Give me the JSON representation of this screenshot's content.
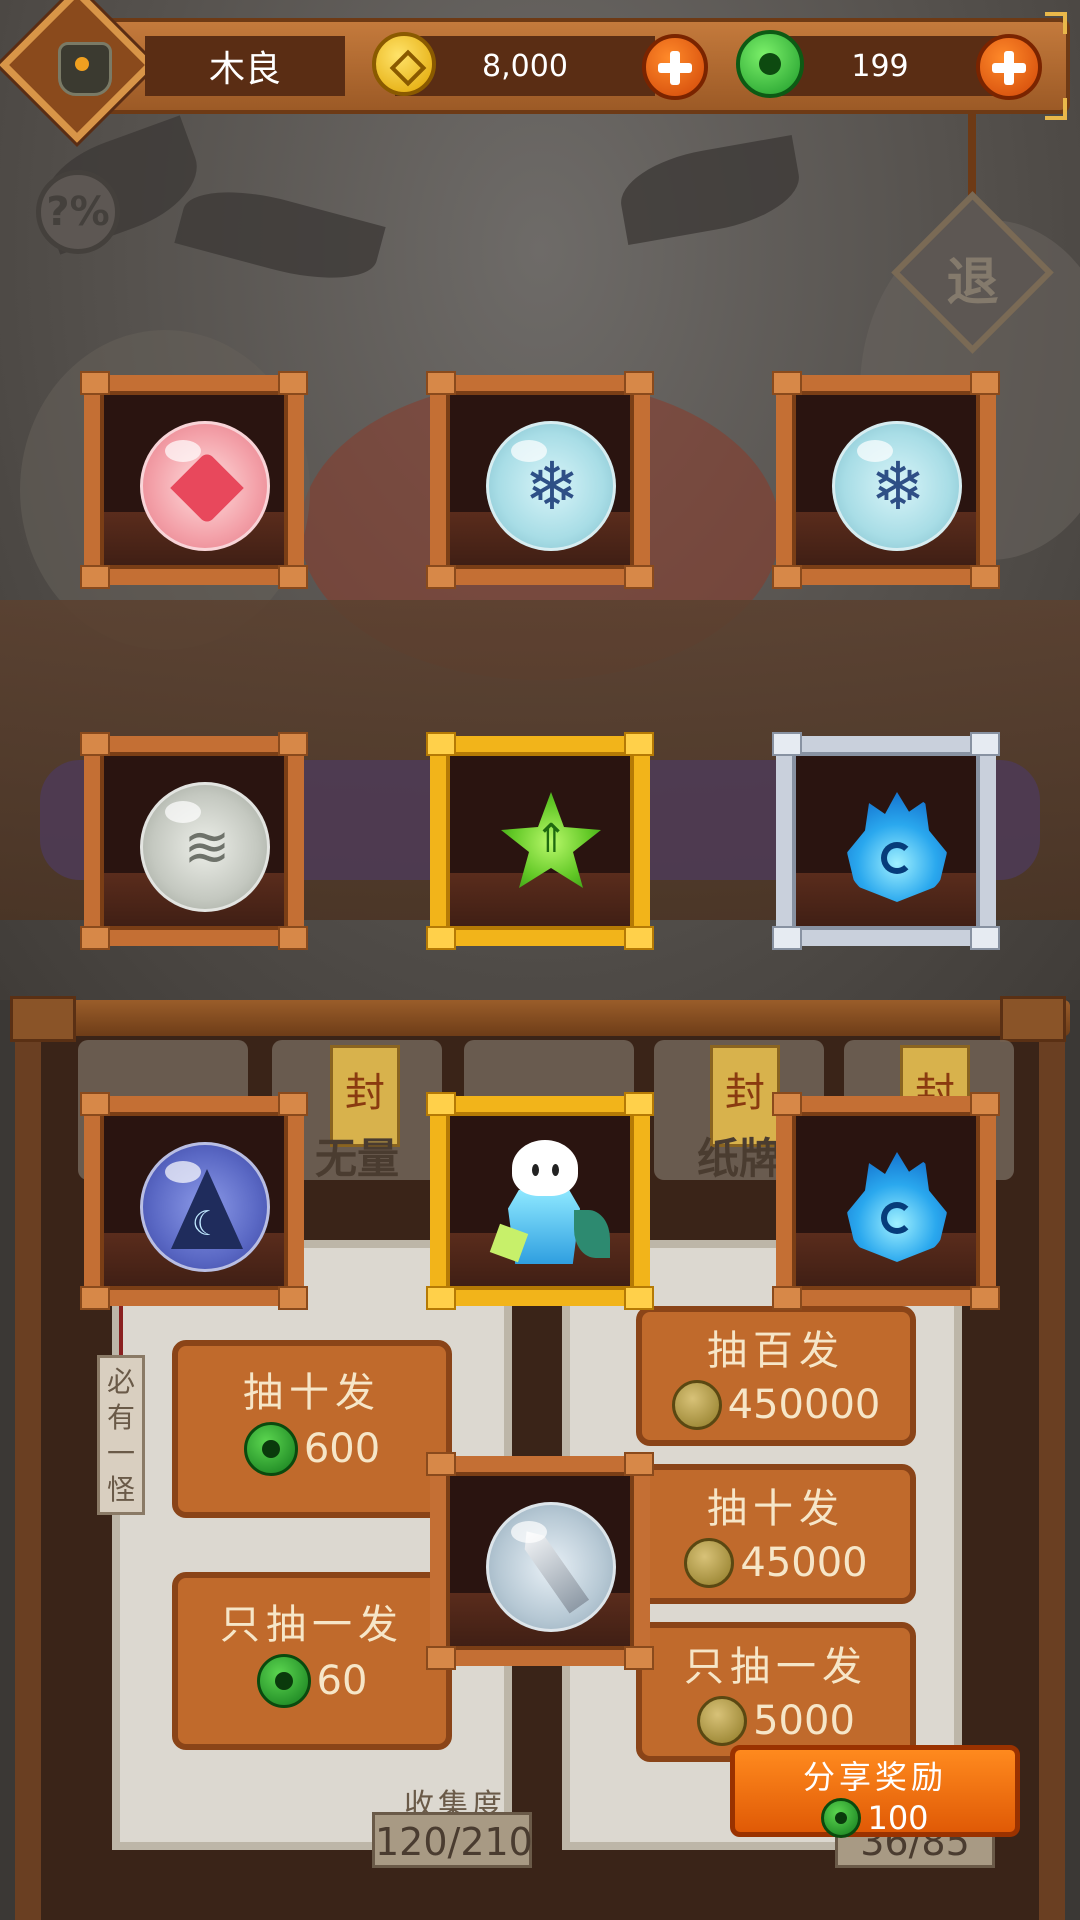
{
  "topbar": {
    "player_name": "木良",
    "gold_amount": "8,000",
    "jade_amount": "199",
    "icons": [
      "avatar-icon",
      "gold-coin-icon",
      "jade-coin-icon",
      "plus-icon"
    ]
  },
  "side": {
    "help_label": "?%",
    "exit_label": "退"
  },
  "categories": [
    {
      "label": ""
    },
    {
      "label": "无量",
      "seal": "封"
    },
    {
      "label": ""
    },
    {
      "label": "纸牌",
      "seal": "封"
    },
    {
      "label": "",
      "seal": "封"
    }
  ],
  "tag": {
    "text": "必有一怪"
  },
  "left_panel": {
    "draw_ten": {
      "title": "抽十发",
      "price": "600",
      "currency": "jade"
    },
    "draw_one": {
      "title": "只抽一发",
      "price": "60",
      "currency": "jade"
    },
    "collection_label": "收集度",
    "collection_value": "120/210"
  },
  "right_panel": {
    "draw_hundred": {
      "title": "抽百发",
      "price": "450000",
      "currency": "gold"
    },
    "draw_ten": {
      "title": "抽十发",
      "price": "45000",
      "currency": "gold"
    },
    "draw_one": {
      "title": "只抽一发",
      "price": "5000",
      "currency": "gold"
    },
    "collection_value": "36/85"
  },
  "share": {
    "title": "分享奖励",
    "price": "100",
    "currency": "jade"
  },
  "rewards": [
    {
      "frame": "bronze",
      "item": "heart-orb"
    },
    {
      "frame": "bronze",
      "item": "snowflake-orb"
    },
    {
      "frame": "bronze",
      "item": "snowflake-orb"
    },
    {
      "frame": "bronze",
      "item": "wind-orb"
    },
    {
      "frame": "gold",
      "item": "green-star-gem"
    },
    {
      "frame": "silver",
      "item": "blue-flame"
    },
    {
      "frame": "bronze",
      "item": "moon-orb"
    },
    {
      "frame": "gold",
      "item": "ice-spirit-character"
    },
    {
      "frame": "bronze",
      "item": "blue-flame"
    },
    {
      "frame": "bronze",
      "item": "sword-orb"
    }
  ],
  "colors": {
    "bronze_frame": "#c46f34",
    "gold_frame": "#f2b41a",
    "silver_frame": "#c9d0dc",
    "accent_orange": "#e05a06"
  }
}
